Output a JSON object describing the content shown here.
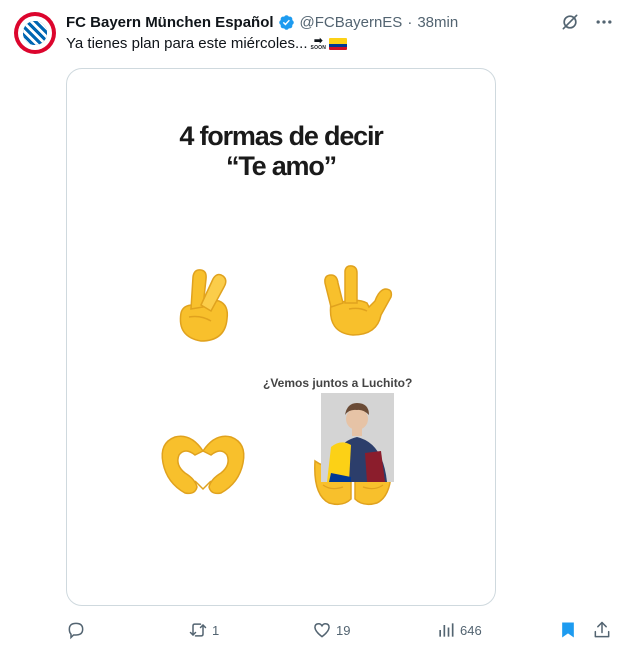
{
  "tweet": {
    "author_name": "FC Bayern München Español",
    "handle": "@FCBayernES",
    "separator": "·",
    "time": "38min",
    "text": "Ya tienes plan para este miércoles...",
    "soon_label": "SOON",
    "verified": true,
    "icons": {
      "grok": "grok-icon",
      "more": "more-icon",
      "verified": "verified-badge-icon"
    }
  },
  "media": {
    "title_line1": "4 formas de decir",
    "title_line2": "“Te amo”",
    "caption": "¿Vemos juntos a Luchito?",
    "emojis": [
      "crossed-fingers",
      "love-you-gesture",
      "heart-hands",
      "palms-up-together"
    ]
  },
  "actions": {
    "reply_count": "",
    "retweet_count": "1",
    "like_count": "19",
    "view_count": "646",
    "icons": [
      "reply-icon",
      "retweet-icon",
      "like-icon",
      "views-icon",
      "bookmark-icon",
      "share-icon"
    ]
  },
  "colors": {
    "text": "#0f1419",
    "secondary": "#536471",
    "accent": "#1d9bf0",
    "bayern_red": "#dc052d",
    "emoji_yellow": "#f8c02c"
  }
}
